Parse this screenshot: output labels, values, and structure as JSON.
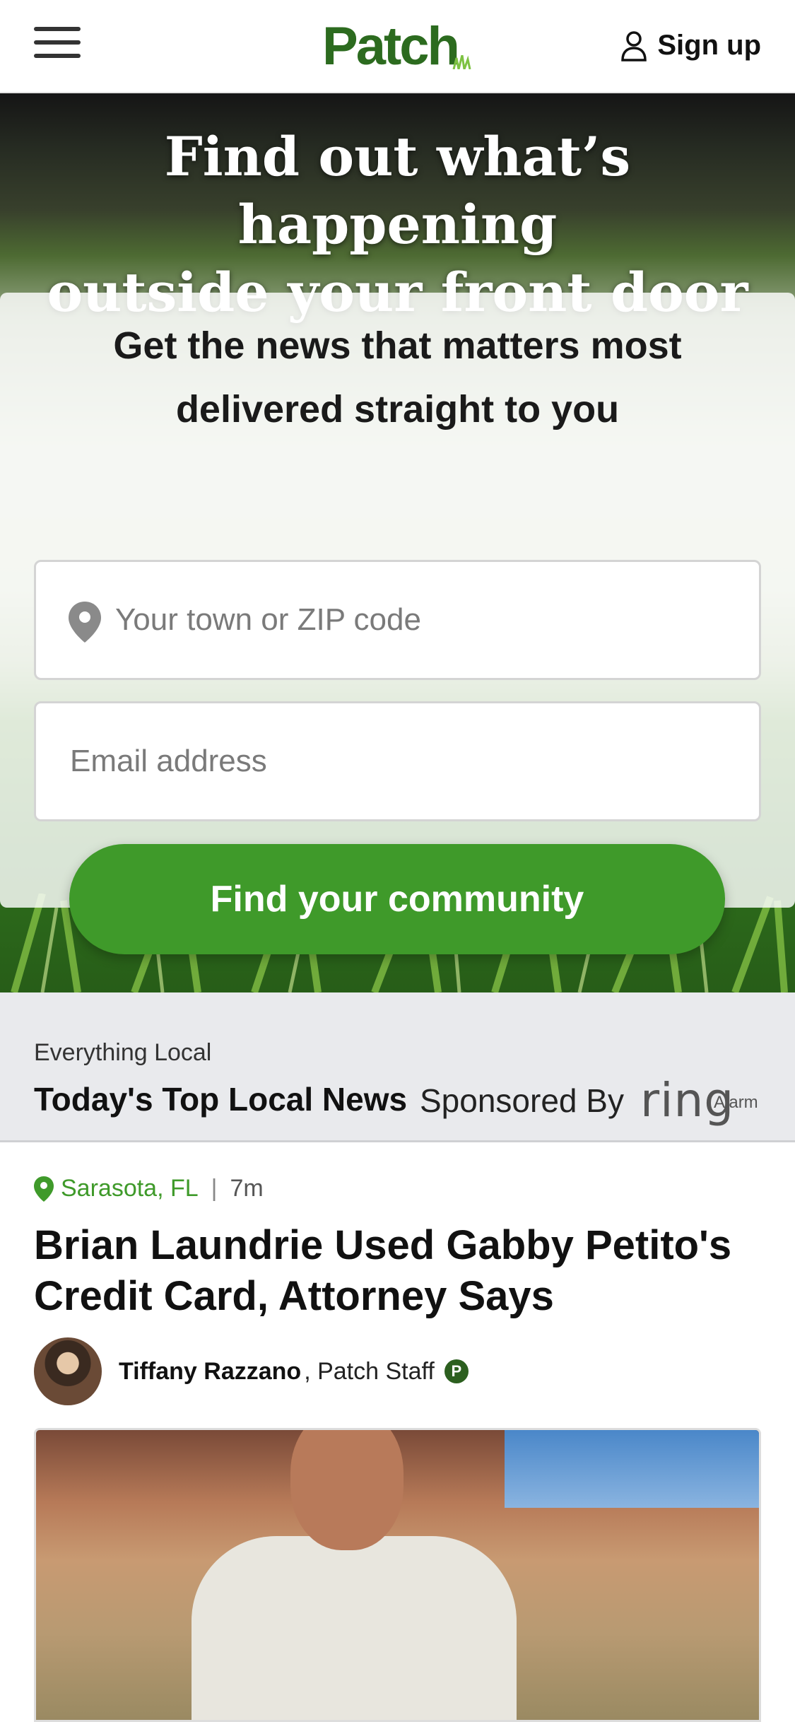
{
  "header": {
    "logo": "Patch",
    "signup_label": "Sign up"
  },
  "hero": {
    "title_line1": "Find out what’s happening",
    "title_line2": "outside your front door",
    "card_heading_line1": "Get the news that matters most",
    "card_heading_line2": "delivered straight to you",
    "town_placeholder": "Your town or ZIP code",
    "email_placeholder": "Email address",
    "cta_label": "Find your community"
  },
  "section": {
    "kicker": "Everything Local",
    "title": "Today's Top Local News",
    "sponsored_label": "Sponsored By",
    "sponsor_logo": "ring",
    "sponsor_sub": "Alarm"
  },
  "article": {
    "location": "Sarasota, FL",
    "separator": "|",
    "time": "7m",
    "headline": "Brian Laundrie Used Gabby Petito's Credit Card, Attorney Says",
    "author": "Tiffany Razzano",
    "author_role": ", Patch Staff",
    "badge": "P"
  },
  "colors": {
    "brand_green": "#3f9a2a",
    "logo_green": "#2c6b1f"
  }
}
